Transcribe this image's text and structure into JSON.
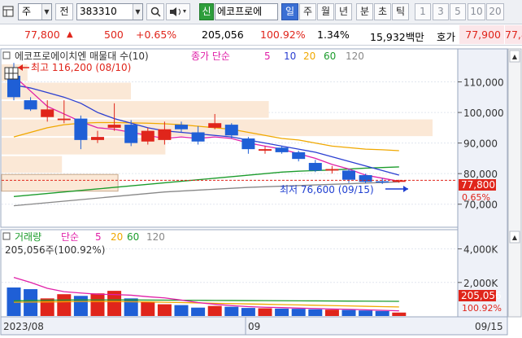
{
  "toolbar": {
    "period_select": "주",
    "prev_label": "전",
    "code_value": "383310",
    "sin_badge": "신",
    "stock_name": "에코프로에",
    "period_tabs": [
      {
        "label": "일",
        "selected": true
      },
      {
        "label": "주",
        "selected": false
      },
      {
        "label": "월",
        "selected": false
      },
      {
        "label": "년",
        "selected": false
      },
      {
        "label": "분",
        "selected": false
      },
      {
        "label": "초",
        "selected": false
      },
      {
        "label": "틱",
        "selected": false
      }
    ],
    "interval_buttons": [
      "1",
      "3",
      "5",
      "10",
      "20"
    ]
  },
  "quote": {
    "price": "77,800",
    "change": "500",
    "change_pct": "+0.65%",
    "volume": "205,056",
    "vol_ratio": "100.92%",
    "turnover_pct": "1.34%",
    "amount": "15,932백만",
    "bid_label": "호가",
    "bid_price": "77,900",
    "ask_price": "77,8"
  },
  "price_panel": {
    "title": "에코프로에이치엔 매물대 수(10)",
    "legend_prefix": "종가 단순",
    "ma_labels": [
      "5",
      "10",
      "20",
      "60",
      "120"
    ],
    "max_label": "최고 116,200 (08/10)",
    "min_label": "최저 76,600 (09/15)",
    "axis_ticks": [
      "110,000",
      "100,000",
      "90,000",
      "80,000",
      "70,000"
    ],
    "last_price_tag": "77,800",
    "last_pct_tag": "0.65%"
  },
  "volume_panel": {
    "title": "거래량",
    "legend_prefix": "단순",
    "ma_labels": [
      "5",
      "20",
      "60",
      "120"
    ],
    "readout": "205,056주(100.92%)",
    "axis_ticks": [
      "4,000K",
      "2,000K"
    ],
    "last_volume_tag": "205,056",
    "last_pct_tag": "100.92%"
  },
  "date_axis": {
    "labels": [
      "2023/08",
      "09",
      "09/15"
    ]
  },
  "chart_data": {
    "type": "candlestick",
    "price_unit": "KRW",
    "ylim_price": [
      63000,
      120000
    ],
    "candles": [
      {
        "o": 112000,
        "h": 116200,
        "l": 104000,
        "c": 105000,
        "up": false
      },
      {
        "o": 104000,
        "h": 105000,
        "l": 100500,
        "c": 101000,
        "up": false
      },
      {
        "o": 101000,
        "h": 104000,
        "l": 97000,
        "c": 98500,
        "up": true
      },
      {
        "o": 98000,
        "h": 104000,
        "l": 96500,
        "c": 97500,
        "up": true
      },
      {
        "o": 98000,
        "h": 99000,
        "l": 88000,
        "c": 91000,
        "up": false
      },
      {
        "o": 91000,
        "h": 94000,
        "l": 90000,
        "c": 92000,
        "up": true
      },
      {
        "o": 95000,
        "h": 103000,
        "l": 94000,
        "c": 96000,
        "up": true
      },
      {
        "o": 96000,
        "h": 97500,
        "l": 89000,
        "c": 90000,
        "up": false
      },
      {
        "o": 94000,
        "h": 95000,
        "l": 89500,
        "c": 90500,
        "up": true
      },
      {
        "o": 94500,
        "h": 97000,
        "l": 89500,
        "c": 91000,
        "up": true
      },
      {
        "o": 96000,
        "h": 97000,
        "l": 93500,
        "c": 94500,
        "up": false
      },
      {
        "o": 93500,
        "h": 95500,
        "l": 89500,
        "c": 90500,
        "up": false
      },
      {
        "o": 95000,
        "h": 99500,
        "l": 94500,
        "c": 96500,
        "up": true
      },
      {
        "o": 96000,
        "h": 96500,
        "l": 91500,
        "c": 92500,
        "up": false
      },
      {
        "o": 91500,
        "h": 92000,
        "l": 86500,
        "c": 88000,
        "up": false
      },
      {
        "o": 88000,
        "h": 89000,
        "l": 86500,
        "c": 87500,
        "up": true
      },
      {
        "o": 88500,
        "h": 89000,
        "l": 86500,
        "c": 87000,
        "up": false
      },
      {
        "o": 87000,
        "h": 87500,
        "l": 84000,
        "c": 84800,
        "up": false
      },
      {
        "o": 83500,
        "h": 84500,
        "l": 80500,
        "c": 81000,
        "up": false
      },
      {
        "o": 81500,
        "h": 82500,
        "l": 80000,
        "c": 81000,
        "up": true
      },
      {
        "o": 81000,
        "h": 81500,
        "l": 77000,
        "c": 78000,
        "up": false
      },
      {
        "o": 79500,
        "h": 80000,
        "l": 76800,
        "c": 77300,
        "up": false
      },
      {
        "o": 77500,
        "h": 78500,
        "l": 76600,
        "c": 77300,
        "up": false
      },
      {
        "o": 77300,
        "h": 78000,
        "l": 77000,
        "c": 77800,
        "up": true
      }
    ],
    "ma5": [
      112000,
      107000,
      102000,
      99500,
      97000,
      95000,
      94500,
      93500,
      92500,
      91500,
      92000,
      91500,
      92000,
      91500,
      90000,
      89000,
      88000,
      86500,
      85000,
      83000,
      81500,
      79500,
      78500,
      77500
    ],
    "ma10": [
      109000,
      108000,
      106500,
      105000,
      103000,
      100000,
      98000,
      96500,
      95000,
      94000,
      93500,
      93000,
      92500,
      92000,
      91000,
      90000,
      89000,
      88000,
      87000,
      85500,
      84000,
      82500,
      81000,
      79500
    ],
    "ma20": [
      92000,
      93500,
      95000,
      96000,
      96500,
      96700,
      96700,
      96600,
      96500,
      96300,
      96000,
      95500,
      95000,
      94500,
      93500,
      92500,
      91500,
      91000,
      90000,
      89000,
      88500,
      88000,
      87800,
      87500
    ],
    "ma60": [
      72500,
      73000,
      73500,
      74000,
      74500,
      75000,
      75500,
      76000,
      76500,
      77000,
      77500,
      78000,
      78500,
      79000,
      79500,
      80000,
      80500,
      80800,
      81000,
      81200,
      81500,
      81800,
      82000,
      82200
    ],
    "ma120": [
      69500,
      70000,
      70500,
      71000,
      71500,
      72000,
      72500,
      73000,
      73500,
      74000,
      74300,
      74600,
      74900,
      75200,
      75500,
      75700,
      75900,
      76100,
      76300,
      76500,
      76700,
      76900,
      77100,
      77300
    ],
    "ylim_volume": [
      0,
      5000000
    ],
    "volumes": [
      1700000,
      1600000,
      1050000,
      1300000,
      1200000,
      1350000,
      1500000,
      1050000,
      850000,
      700000,
      650000,
      500000,
      600000,
      550000,
      480000,
      460000,
      440000,
      430000,
      400000,
      380000,
      360000,
      330000,
      300000,
      205056
    ],
    "vol_ma5": [
      2300000,
      2000000,
      1650000,
      1450000,
      1370000,
      1300000,
      1280000,
      1240000,
      1150000,
      1080000,
      950000,
      800000,
      700000,
      620000,
      560000,
      520000,
      500000,
      470000,
      450000,
      420000,
      400000,
      370000,
      340000,
      310000
    ],
    "vol_ma20": [
      820000,
      830000,
      840000,
      850000,
      860000,
      860000,
      860000,
      850000,
      840000,
      820000,
      800000,
      780000,
      760000,
      740000,
      720000,
      700000,
      680000,
      660000,
      640000,
      620000,
      600000,
      580000,
      560000,
      540000
    ],
    "vol_ma60": [
      900000,
      920000,
      940000,
      950000,
      960000,
      960000,
      960000,
      955000,
      950000,
      945000,
      940000,
      935000,
      930000,
      925000,
      920000,
      915000,
      910000,
      905000,
      900000,
      895000,
      890000,
      885000,
      880000,
      875000
    ],
    "volume_profile": [
      {
        "from": 110000,
        "to": 116000,
        "share": 0.06
      },
      {
        "from": 104000,
        "to": 110000,
        "share": 0.3
      },
      {
        "from": 98000,
        "to": 104000,
        "share": 0.62
      },
      {
        "from": 92000,
        "to": 98000,
        "share": 1.0
      },
      {
        "from": 86000,
        "to": 92000,
        "share": 0.38
      },
      {
        "from": 80000,
        "to": 86000,
        "share": 0.14
      },
      {
        "from": 74000,
        "to": 80000,
        "share": 0.27
      }
    ],
    "colors": {
      "up": "#e0251b",
      "down": "#1f5fd6",
      "ma5": "#e020a8",
      "ma10": "#2b3fd1",
      "ma20": "#f0a800",
      "ma60": "#1c9c2c",
      "ma120": "#888888",
      "profile": "#fbe8d6"
    }
  }
}
